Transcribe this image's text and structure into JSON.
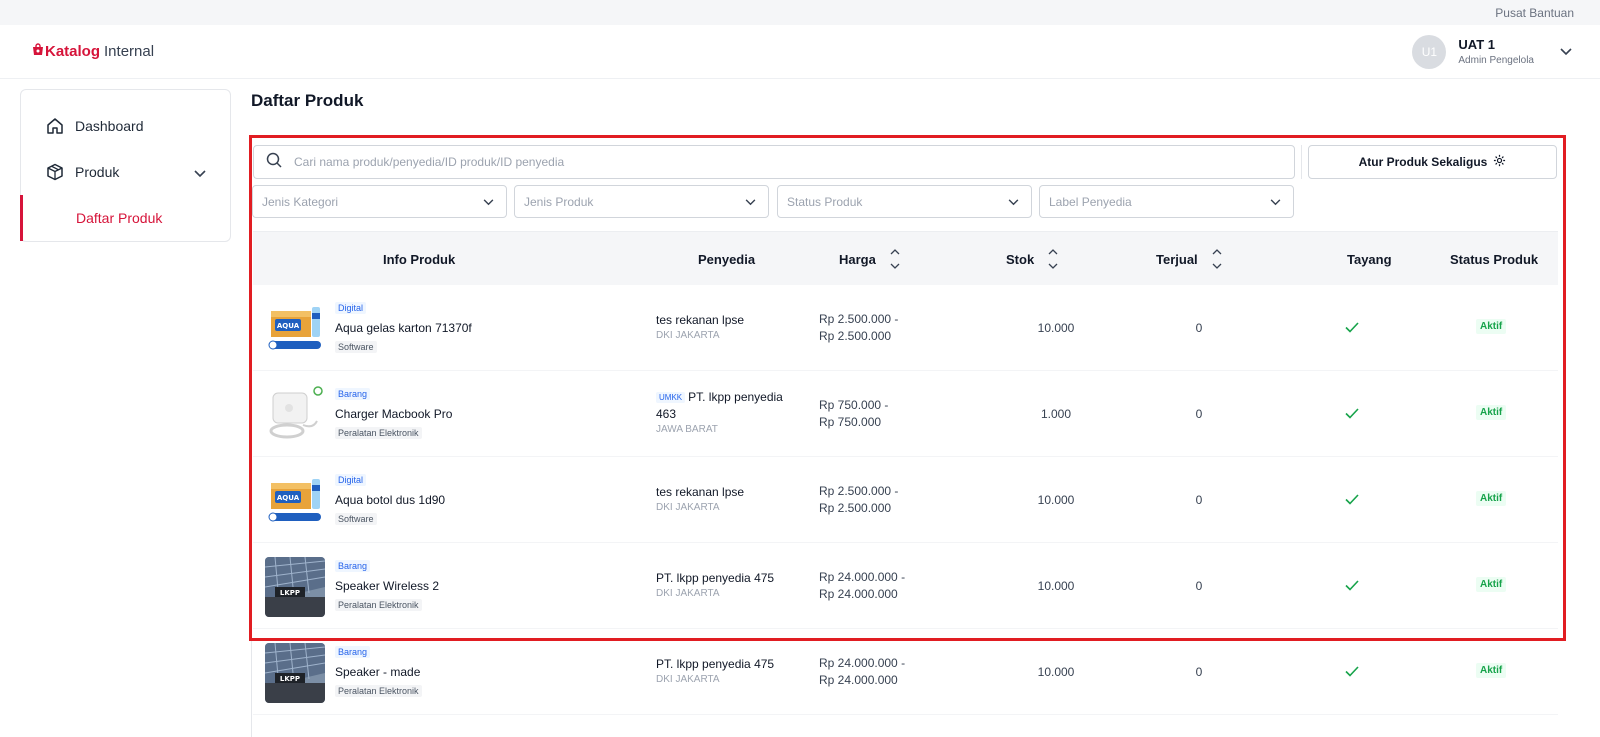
{
  "topbar": {
    "help": "Pusat Bantuan"
  },
  "brand": {
    "name": "Katalog",
    "suffix": "Internal",
    "color": "#d6143a"
  },
  "user": {
    "initials": "U1",
    "name": "UAT 1",
    "role": "Admin Pengelola"
  },
  "sidebar": {
    "items": [
      {
        "label": "Dashboard",
        "icon": "home-icon"
      },
      {
        "label": "Produk",
        "icon": "box-icon"
      }
    ],
    "sub_items": [
      {
        "label": "Daftar Produk",
        "active": true
      }
    ]
  },
  "page": {
    "title": "Daftar Produk"
  },
  "search": {
    "placeholder": "Cari nama produk/penyedia/ID produk/ID penyedia",
    "value": ""
  },
  "bulk_button": {
    "label": "Atur Produk Sekaligus"
  },
  "filters": [
    {
      "placeholder": "Jenis Kategori"
    },
    {
      "placeholder": "Jenis Produk"
    },
    {
      "placeholder": "Status Produk"
    },
    {
      "placeholder": "Label Penyedia"
    }
  ],
  "table": {
    "headers": {
      "info": "Info Produk",
      "vendor": "Penyedia",
      "price": "Harga",
      "stock": "Stok",
      "sold": "Terjual",
      "live": "Tayang",
      "status": "Status Produk"
    },
    "rows": [
      {
        "type": "Digital",
        "name": "Aqua gelas karton 71370f",
        "category": "Software",
        "umkk": "",
        "vendor": "tes rekanan lpse",
        "region": "DKI JAKARTA",
        "price_min": "Rp 2.500.000 -",
        "price_max": "Rp 2.500.000",
        "stock": "10.000",
        "sold": "0",
        "status": "Aktif",
        "thumb": "aqua"
      },
      {
        "type": "Barang",
        "name": "Charger Macbook Pro",
        "category": "Peralatan Elektronik",
        "umkk": "UMKK",
        "vendor": "PT. lkpp penyedia 463",
        "region": "JAWA BARAT",
        "price_min": "Rp 750.000 -",
        "price_max": "Rp 750.000",
        "stock": "1.000",
        "sold": "0",
        "status": "Aktif",
        "thumb": "charger"
      },
      {
        "type": "Digital",
        "name": "Aqua botol dus 1d90",
        "category": "Software",
        "umkk": "",
        "vendor": "tes rekanan lpse",
        "region": "DKI JAKARTA",
        "price_min": "Rp 2.500.000 -",
        "price_max": "Rp 2.500.000",
        "stock": "10.000",
        "sold": "0",
        "status": "Aktif",
        "thumb": "aqua"
      },
      {
        "type": "Barang",
        "name": "Speaker Wireless 2",
        "category": "Peralatan Elektronik",
        "umkk": "",
        "vendor": "PT. lkpp penyedia 475",
        "region": "DKI JAKARTA",
        "price_min": "Rp 24.000.000 -",
        "price_max": "Rp 24.000.000",
        "stock": "10.000",
        "sold": "0",
        "status": "Aktif",
        "thumb": "building"
      },
      {
        "type": "Barang",
        "name": "Speaker - made",
        "category": "Peralatan Elektronik",
        "umkk": "",
        "vendor": "PT. lkpp penyedia 475",
        "region": "DKI JAKARTA",
        "price_min": "Rp 24.000.000 -",
        "price_max": "Rp 24.000.000",
        "stock": "10.000",
        "sold": "0",
        "status": "Aktif",
        "thumb": "building"
      }
    ]
  },
  "colors": {
    "accent": "#d6143a",
    "success": "#16a34a",
    "link": "#2563eb",
    "highlight": "#e11d22"
  }
}
